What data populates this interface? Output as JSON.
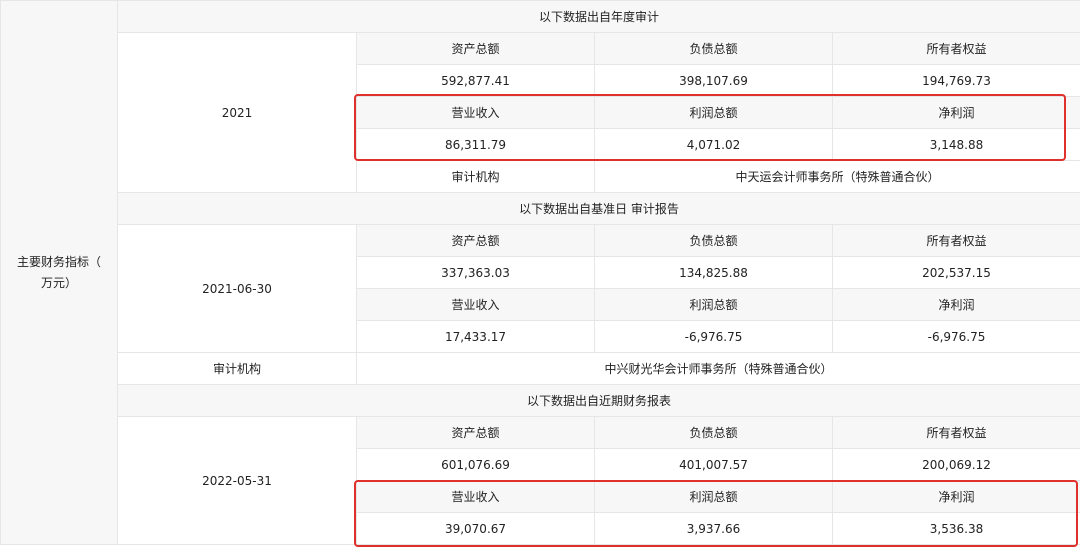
{
  "row_label": "主要财务指标（\n万元）",
  "audit_label": "审计机构",
  "sections": [
    {
      "source": "以下数据出自年度审计",
      "date": "2021",
      "balance_headers": [
        "资产总额",
        "负债总额",
        "所有者权益"
      ],
      "balance_values": [
        "592,877.41",
        "398,107.69",
        "194,769.73"
      ],
      "income_headers": [
        "营业收入",
        "利润总额",
        "净利润"
      ],
      "income_values": [
        "86,311.79",
        "4,071.02",
        "3,148.88"
      ],
      "auditor": "中天运会计师事务所（特殊普通合伙）",
      "income_highlighted": true
    },
    {
      "source": "以下数据出自基准日 审计报告",
      "date": "2021-06-30",
      "balance_headers": [
        "资产总额",
        "负债总额",
        "所有者权益"
      ],
      "balance_values": [
        "337,363.03",
        "134,825.88",
        "202,537.15"
      ],
      "income_headers": [
        "营业收入",
        "利润总额",
        "净利润"
      ],
      "income_values": [
        "17,433.17",
        "-6,976.75",
        "-6,976.75"
      ],
      "auditor": "中兴财光华会计师事务所（特殊普通合伙）",
      "income_highlighted": false
    },
    {
      "source": "以下数据出自近期财务报表",
      "date": "2022-05-31",
      "balance_headers": [
        "资产总额",
        "负债总额",
        "所有者权益"
      ],
      "balance_values": [
        "601,076.69",
        "401,007.57",
        "200,069.12"
      ],
      "income_headers": [
        "营业收入",
        "利润总额",
        "净利润"
      ],
      "income_values": [
        "39,070.67",
        "3,937.66",
        "3,536.38"
      ],
      "income_highlighted": true
    }
  ],
  "colors": {
    "highlight": "#e0302b",
    "shade": "#f7f7f7",
    "border": "#e6e6e6"
  }
}
